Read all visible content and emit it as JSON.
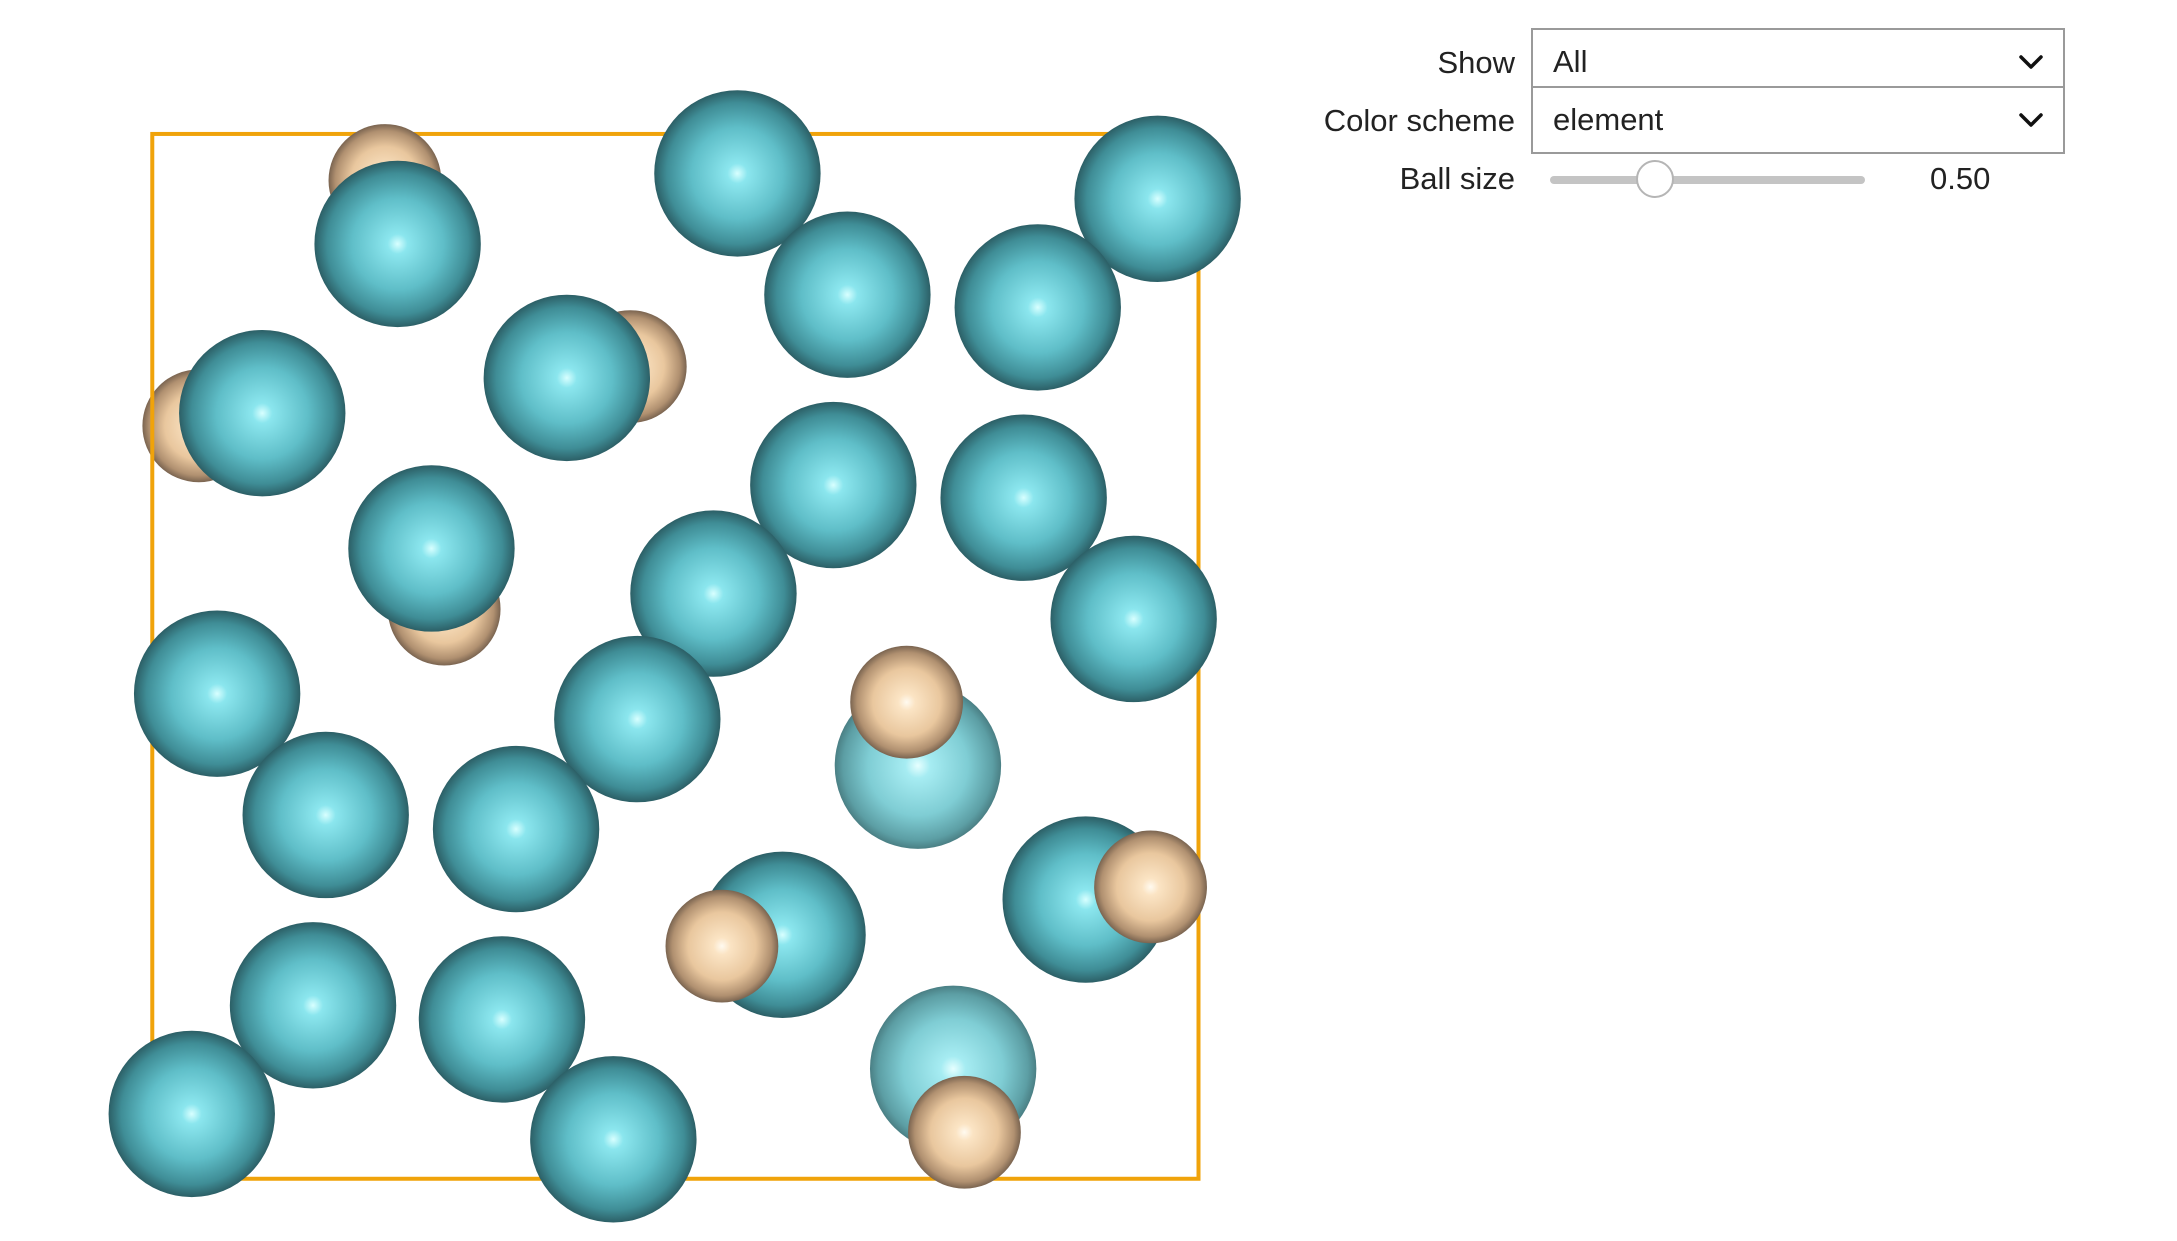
{
  "controls": {
    "show": {
      "label": "Show",
      "value": "All"
    },
    "color_scheme": {
      "label": "Color scheme",
      "value": "element"
    },
    "ball_size": {
      "label": "Ball size",
      "value_text": "0.50",
      "value": 0.5,
      "min": 0,
      "max": 1.5
    }
  },
  "structure": {
    "colors": {
      "unit_cell": "#f0a30a",
      "atom_teal": "#5fbec8",
      "atom_beige": "#f2d1a8"
    },
    "atoms": [
      {
        "element": "beige"
      },
      {
        "element": "teal"
      },
      {
        "element": "teal"
      },
      {
        "element": "teal"
      },
      {
        "element": "teal"
      },
      {
        "element": "teal"
      },
      {
        "element": "teal"
      },
      {
        "element": "beige"
      },
      {
        "element": "teal"
      },
      {
        "element": "beige"
      },
      {
        "element": "teal"
      },
      {
        "element": "teal"
      },
      {
        "element": "teal"
      },
      {
        "element": "beige"
      },
      {
        "element": "teal"
      },
      {
        "element": "teal"
      },
      {
        "element": "teal"
      },
      {
        "element": "teal"
      },
      {
        "element": "teal"
      },
      {
        "element": "teal"
      },
      {
        "element": "teal"
      },
      {
        "element": "teal"
      },
      {
        "element": "teal"
      },
      {
        "element": "beige"
      },
      {
        "element": "teal"
      },
      {
        "element": "beige"
      },
      {
        "element": "teal"
      },
      {
        "element": "teal"
      },
      {
        "element": "teal"
      },
      {
        "element": "teal"
      },
      {
        "element": "beige"
      },
      {
        "element": "beige"
      }
    ]
  }
}
